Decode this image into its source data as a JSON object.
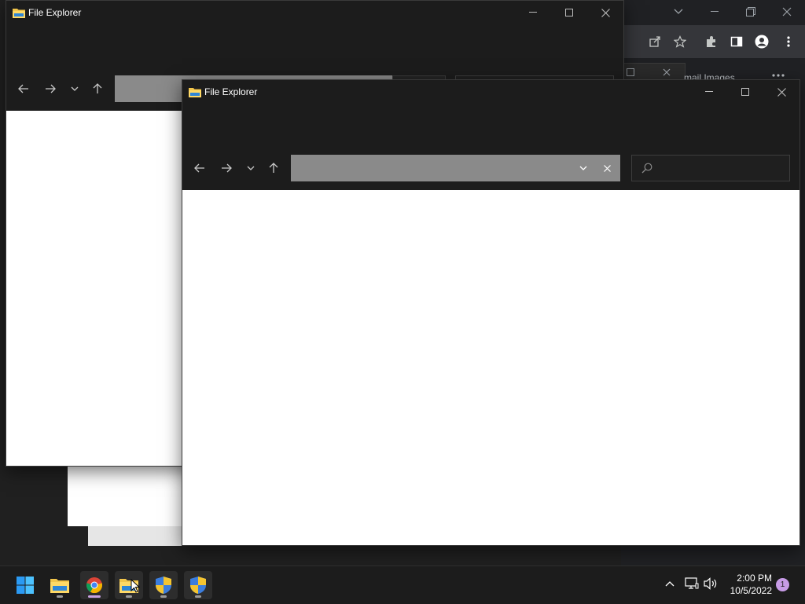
{
  "chrome_window": {
    "tab_partial_text": "mail   Images",
    "icons": [
      "chevron-down-icon",
      "minimize-icon",
      "restore-icon",
      "close-icon",
      "share-icon",
      "star-icon",
      "extensions-icon",
      "side-panel-icon",
      "profile-icon",
      "menu-kebab-icon"
    ]
  },
  "explorer_back": {
    "title": "File Explorer"
  },
  "explorer_front": {
    "title": "File Explorer",
    "address_value": "",
    "search_placeholder": ""
  },
  "taskbar": {
    "apps": [
      "start",
      "file-explorer",
      "chrome",
      "file-explorer-2",
      "shield-app-1",
      "shield-app-2"
    ],
    "clock_time": "2:00 PM",
    "clock_date": "10/5/2022",
    "notification_count": "1"
  },
  "colors": {
    "taskbar_bg": "#1c1c1c",
    "window_bg": "#1c1c1c",
    "address_bar": "#8a8a8a",
    "notification_badge": "#c79be6",
    "start_blue": "#2b9af3"
  }
}
